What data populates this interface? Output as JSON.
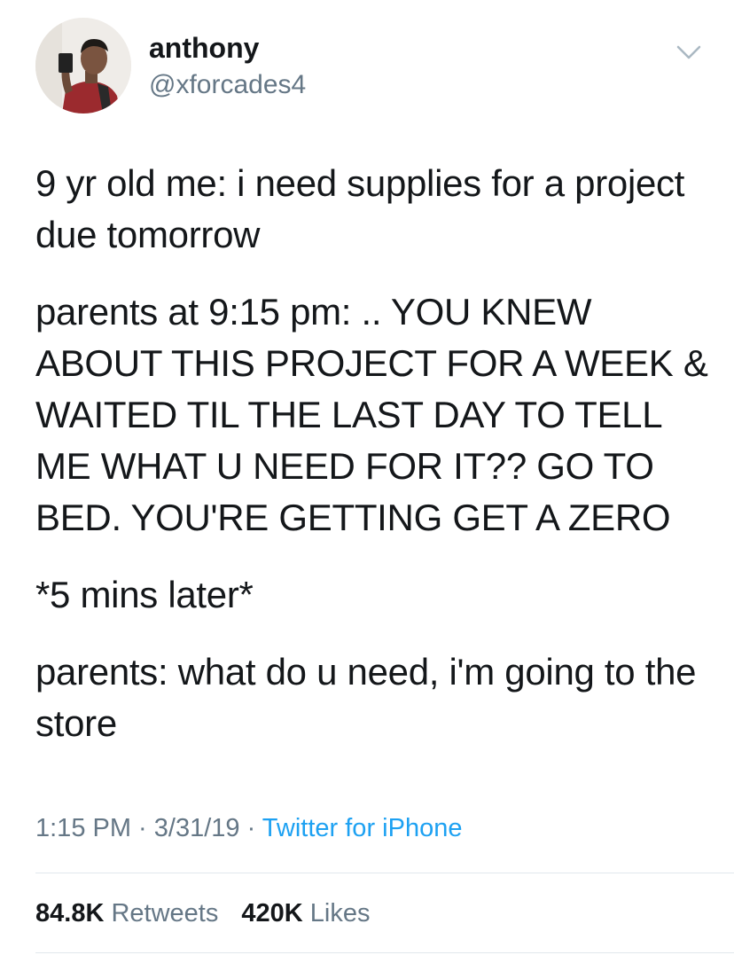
{
  "user": {
    "name": "anthony",
    "handle": "@xforcades4"
  },
  "tweet": {
    "paragraphs": [
      "9 yr old me: i need supplies for a project due tomorrow",
      "parents at 9:15 pm: .. YOU KNEW ABOUT THIS PROJECT FOR A WEEK & WAITED TIL THE LAST DAY TO TELL ME WHAT U NEED FOR IT?? GO TO BED. YOU'RE GETTING GET A ZERO",
      "*5 mins later*",
      "parents: what do u need, i'm going to the store"
    ]
  },
  "meta": {
    "time": "1:15 PM",
    "separator": " · ",
    "date": "3/31/19",
    "source": "Twitter for iPhone"
  },
  "stats": {
    "retweets_count": "84.8K",
    "retweets_label": "Retweets",
    "likes_count": "420K",
    "likes_label": "Likes"
  },
  "colors": {
    "text": "#14171a",
    "secondary": "#657786",
    "link": "#1da1f2",
    "divider": "#e1e8ed"
  },
  "icons": {
    "menu": "chevron-down-icon"
  }
}
